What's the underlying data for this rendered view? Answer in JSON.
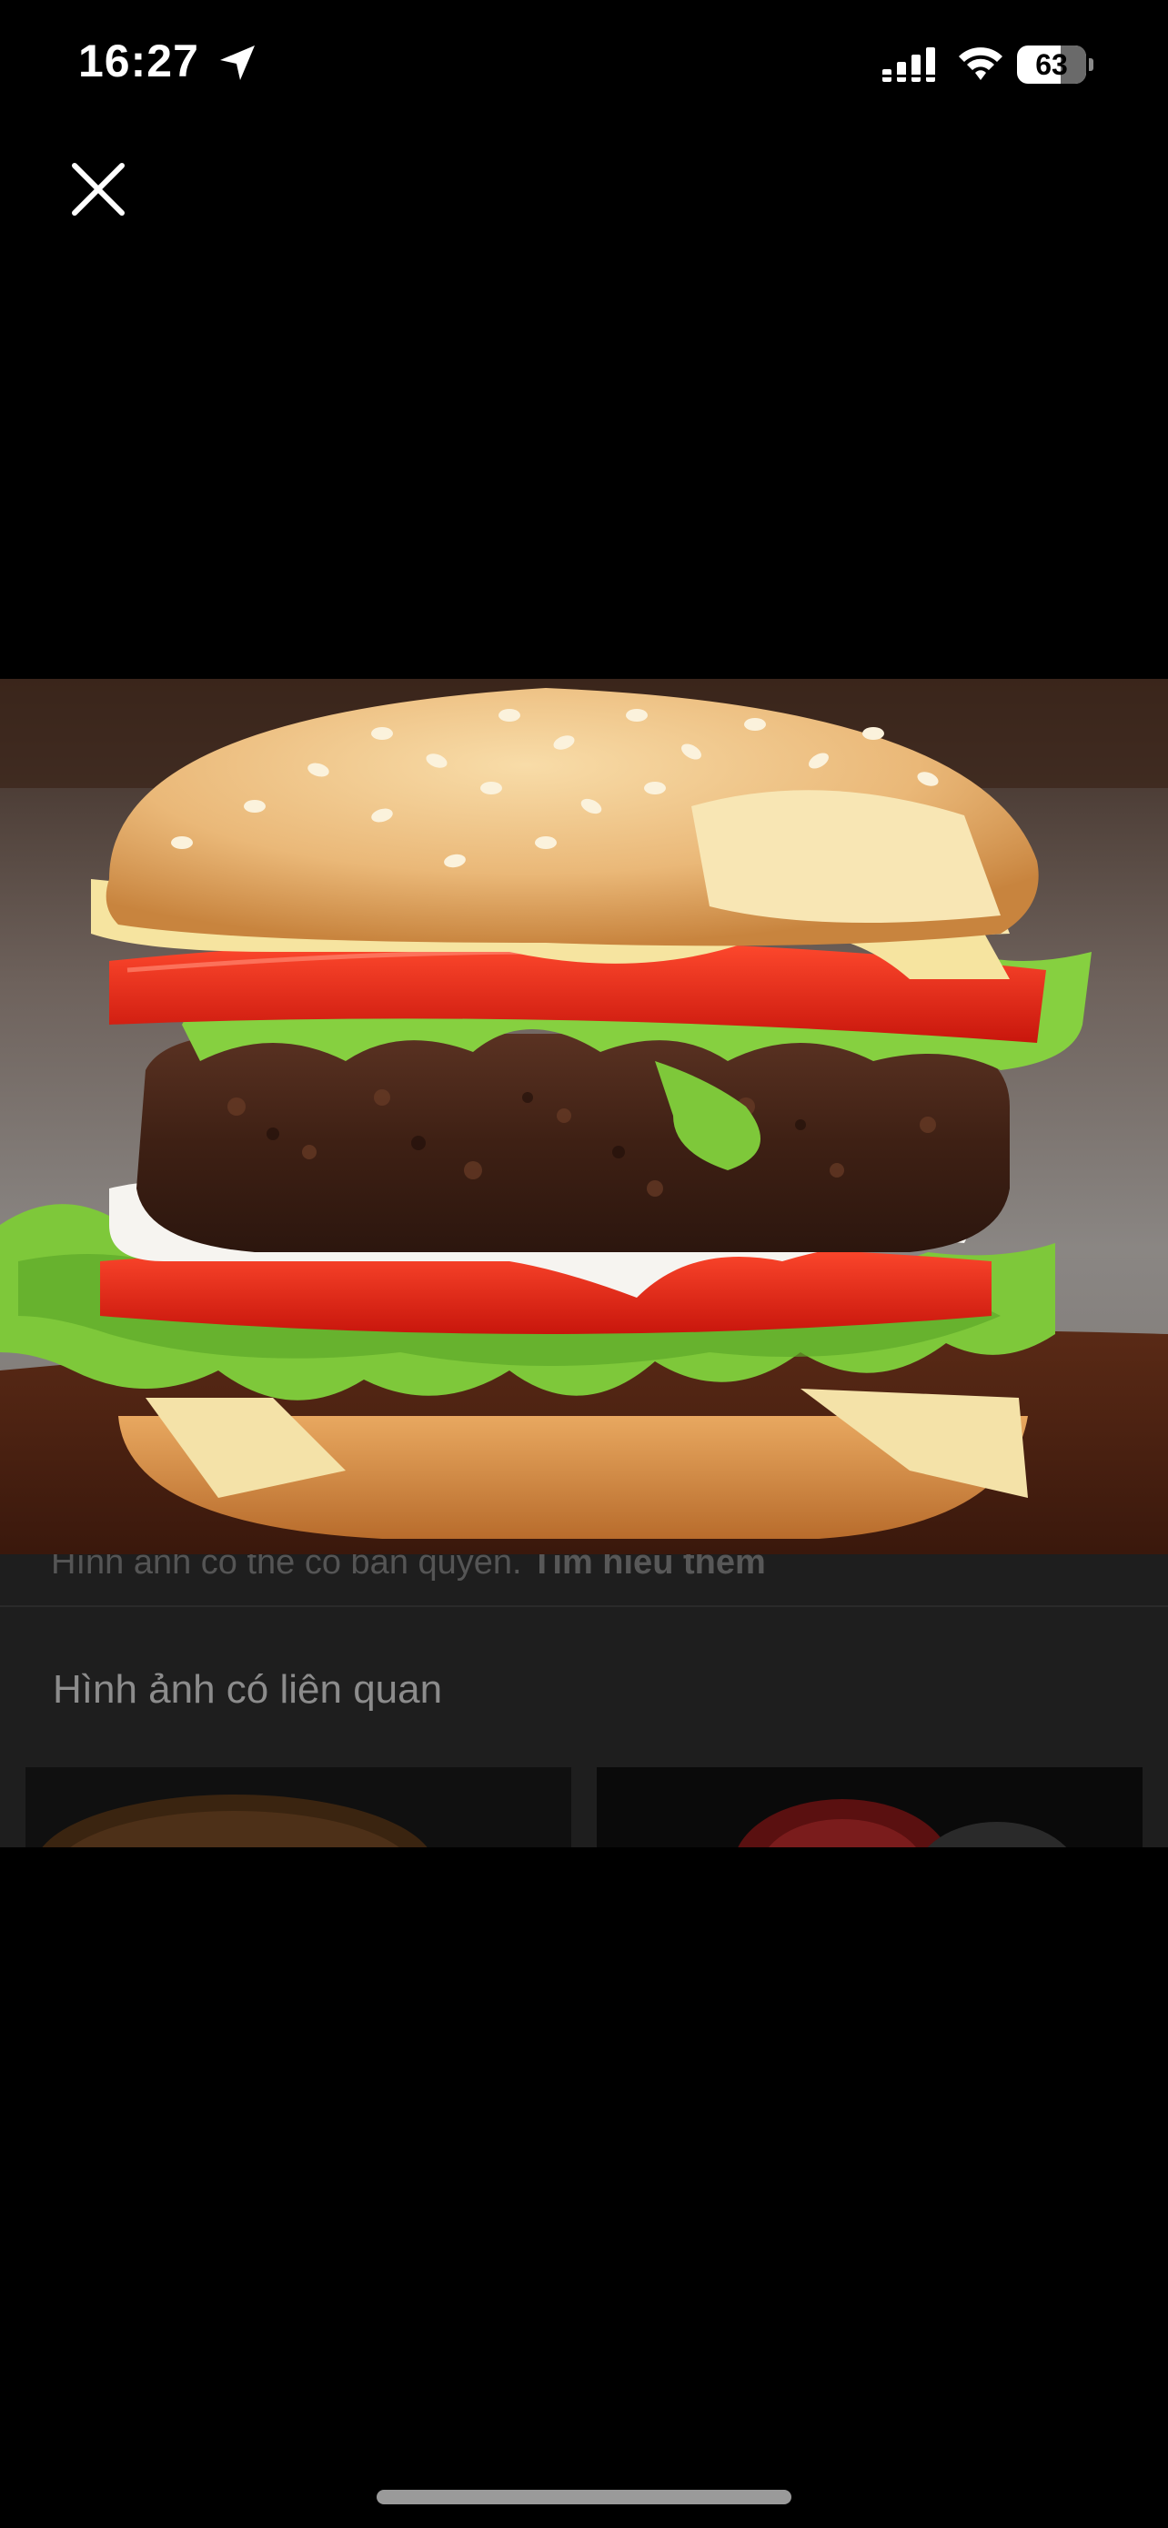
{
  "status_bar": {
    "time": "16:27",
    "battery": "63",
    "icons": [
      "location-arrow-icon",
      "cellular-signal-icon",
      "wifi-icon",
      "battery-icon"
    ]
  },
  "viewer": {
    "close_icon": "close-icon",
    "photo_subject": "burger-photo"
  },
  "background_sheet": {
    "copyright_text": "Hình ảnh có thể có bản quyền.",
    "learn_more": "Tìm hiểu thêm",
    "related_title": "Hình ảnh có liên quan"
  },
  "colors": {
    "background": "#000000",
    "sheet": "#1e1e1e"
  }
}
